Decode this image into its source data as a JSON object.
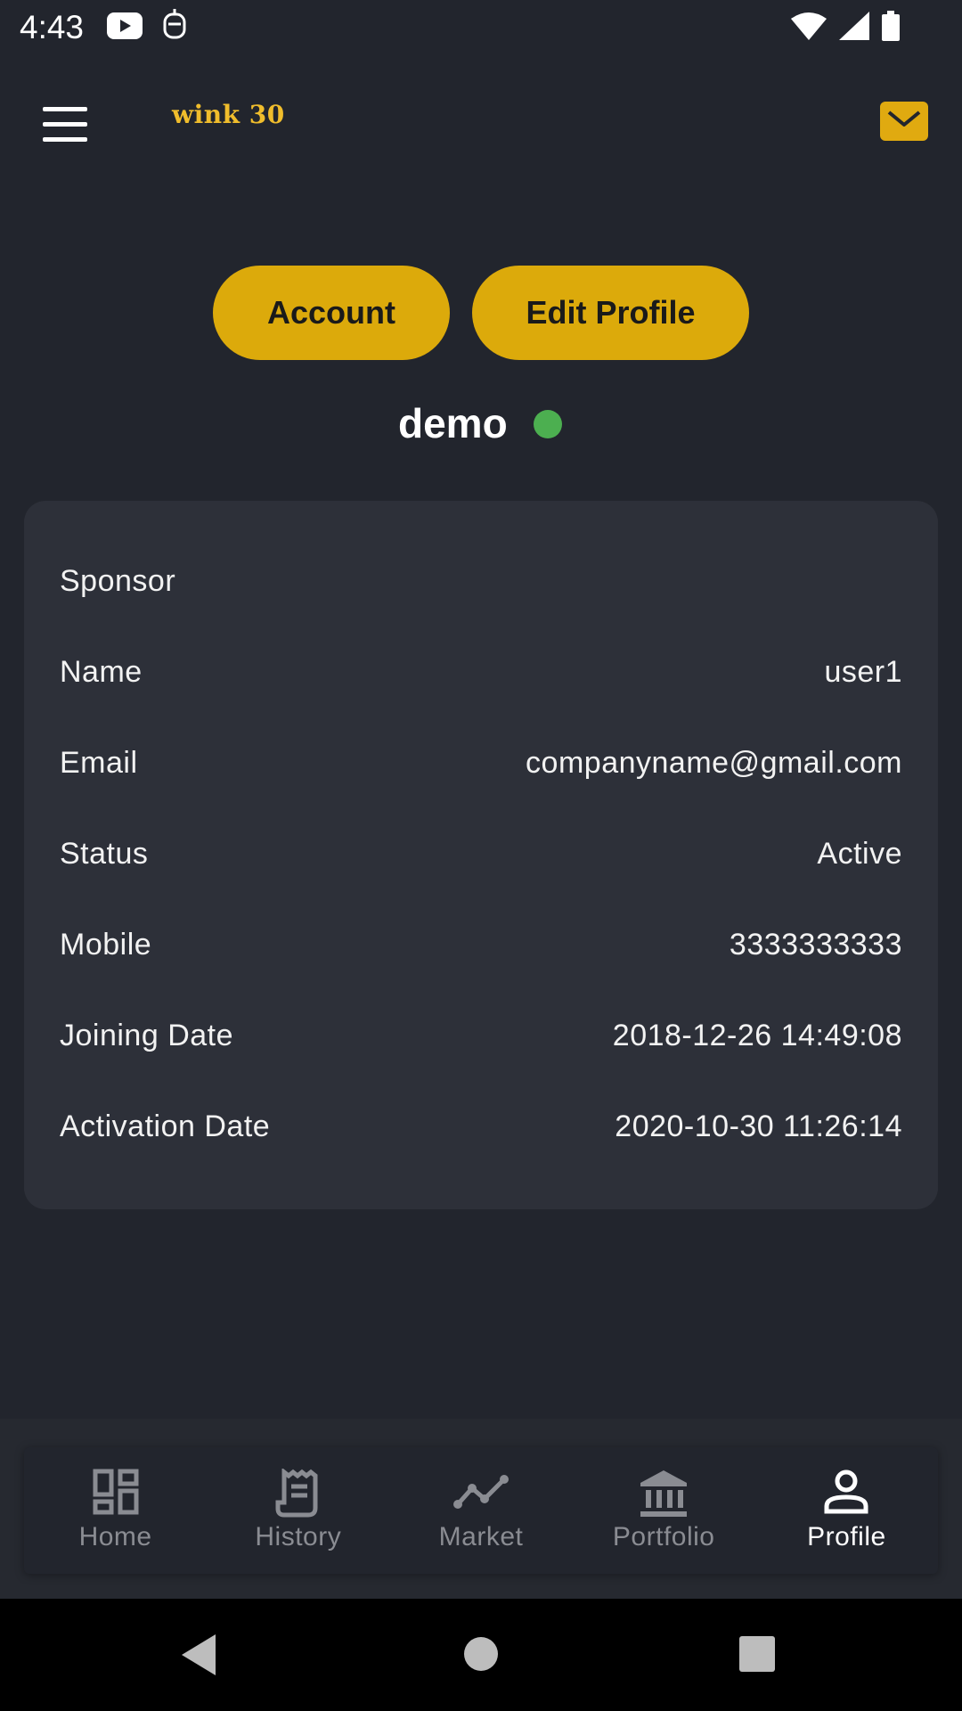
{
  "status_bar": {
    "time": "4:43"
  },
  "app_bar": {
    "logo": "wink 30"
  },
  "actions": {
    "account_label": "Account",
    "edit_profile_label": "Edit Profile"
  },
  "profile": {
    "username": "demo",
    "online_color": "#4caf50"
  },
  "details": [
    {
      "label": "Sponsor",
      "value": ""
    },
    {
      "label": "Name",
      "value": "user1"
    },
    {
      "label": "Email",
      "value": "companyname@gmail.com"
    },
    {
      "label": "Status",
      "value": "Active"
    },
    {
      "label": "Mobile",
      "value": "3333333333"
    },
    {
      "label": "Joining Date",
      "value": "2018-12-26 14:49:08"
    },
    {
      "label": "Activation Date",
      "value": "2020-10-30 11:26:14"
    }
  ],
  "bottom_nav": [
    {
      "label": "Home",
      "icon": "dashboard-icon",
      "active": false
    },
    {
      "label": "History",
      "icon": "receipt-icon",
      "active": false
    },
    {
      "label": "Market",
      "icon": "trend-line-icon",
      "active": false
    },
    {
      "label": "Portfolio",
      "icon": "bank-icon",
      "active": false
    },
    {
      "label": "Profile",
      "icon": "person-icon",
      "active": true
    }
  ],
  "colors": {
    "accent": "#dcaa0b",
    "background": "#22252d",
    "card": "#2d3039"
  }
}
